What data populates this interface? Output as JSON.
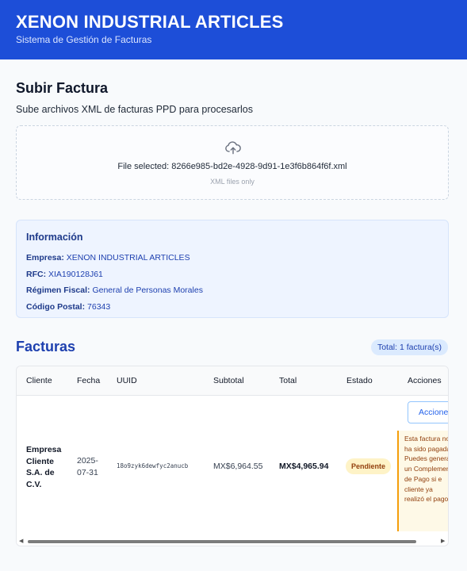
{
  "header": {
    "title": "XENON INDUSTRIAL ARTICLES",
    "subtitle": "Sistema de Gestión de Facturas"
  },
  "upload": {
    "title": "Subir Factura",
    "description": "Sube archivos XML de facturas PPD para procesarlos",
    "icon": "cloud-upload-icon",
    "file_selected": "File selected: 8266e985-bd2e-4928-9d91-1e3f6b864f6f.xml",
    "hint": "XML files only"
  },
  "info": {
    "title": "Información",
    "rows": [
      {
        "label": "Empresa:",
        "value": "XENON INDUSTRIAL ARTICLES"
      },
      {
        "label": "RFC:",
        "value": "XIA190128J61"
      },
      {
        "label": "Régimen Fiscal:",
        "value": "General de Personas Morales"
      },
      {
        "label": "Código Postal:",
        "value": "76343"
      }
    ]
  },
  "facturas": {
    "title": "Facturas",
    "total": "Total: 1 factura(s)",
    "columns": [
      "Cliente",
      "Fecha",
      "UUID",
      "Subtotal",
      "Total",
      "Estado",
      "Acciones"
    ],
    "rows": [
      {
        "cliente": "Empresa Cliente S.A. de C.V.",
        "fecha": "2025-07-31",
        "uuid": "18o9zyk6dewfyc2anucb",
        "subtotal": "MX$6,964.55",
        "total": "MX$4,965.94",
        "estado": "Pendiente",
        "accion_label": "Accione",
        "warning": "Esta factura no ha sido pagada. Puedes generar un Complemen de Pago si e cliente ya realizó el pago."
      }
    ]
  },
  "colors": {
    "header_bg": "#1d4ed8",
    "accent": "#1e40af",
    "badge_bg": "#fef3c7",
    "badge_text": "#92400e"
  }
}
